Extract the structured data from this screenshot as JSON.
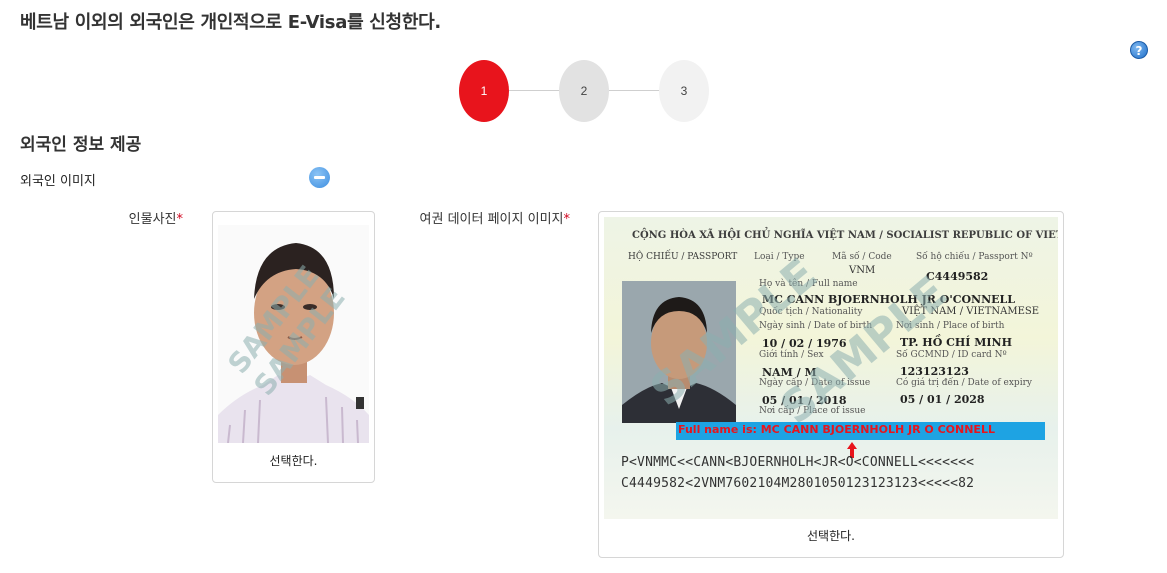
{
  "page": {
    "title": "베트남 이외의 외국인은 개인적으로 E-Visa를 신청한다.",
    "help_icon_glyph": "?"
  },
  "stepper": {
    "steps": [
      {
        "label": "1",
        "state": "active",
        "color": "#e8141c"
      },
      {
        "label": "2",
        "state": "inactive"
      },
      {
        "label": "3",
        "state": "inactive"
      }
    ]
  },
  "section": {
    "title": "외국인 정보 제공",
    "subsection_label": "외국인 이미지",
    "collapse_icon": "minus-circle-icon"
  },
  "fields": {
    "portrait": {
      "label": "인물사진",
      "required_mark": "*",
      "watermark": "SAMPLE",
      "select_label": "선택한다."
    },
    "passport": {
      "label": "여권 데이터 페이지 이미지",
      "required_mark": "*",
      "select_label": "선택한다.",
      "watermark": "SAMPLE",
      "sample": {
        "header": "CỘNG HÒA XÃ HỘI CHỦ NGHĨA VIỆT NAM / SOCIALIST REPUBLIC OF VIETNAM",
        "doc_type": "HỘ CHIẾU / PASSPORT",
        "type_label": "Loại / Type",
        "code_label": "Mã số / Code",
        "code_value": "VNM",
        "passport_no_label": "Số hộ chiếu / Passport Nº",
        "passport_no": "C4449582",
        "fullname_label": "Họ và tên / Full name",
        "fullname": "MC CANN BJOERNHOLH JR O'CONNELL",
        "nationality_label": "Quốc tịch / Nationality",
        "nationality": "VIỆT NAM / VIETNAMESE",
        "dob_label": "Ngày sinh / Date of birth",
        "dob": "10 / 02 / 1976",
        "pob_label": "Nơi sinh / Place of birth",
        "pob": "TP. HỒ CHÍ MINH",
        "sex_label": "Giới tính / Sex",
        "sex": "NAM / M",
        "id_label": "Số GCMND / ID card Nº",
        "id": "123123123",
        "issue_label": "Ngày cấp / Date of issue",
        "issue": "05 / 01 / 2018",
        "expiry_label": "Có giá trị đến / Date of expiry",
        "expiry": "05 / 01 / 2028",
        "poi_label": "Nơi cấp / Place of issue",
        "callout": "Full name is: MC CANN BJOERNHOLH JR O CONNELL",
        "mrz_line1": "P<VNMMC<<CANN<BJOERNHOLH<JR<O<CONNELL<<<<<<<",
        "mrz_line2": "C4449582<2VNM7602104M2801050123123123<<<<<82"
      }
    }
  }
}
